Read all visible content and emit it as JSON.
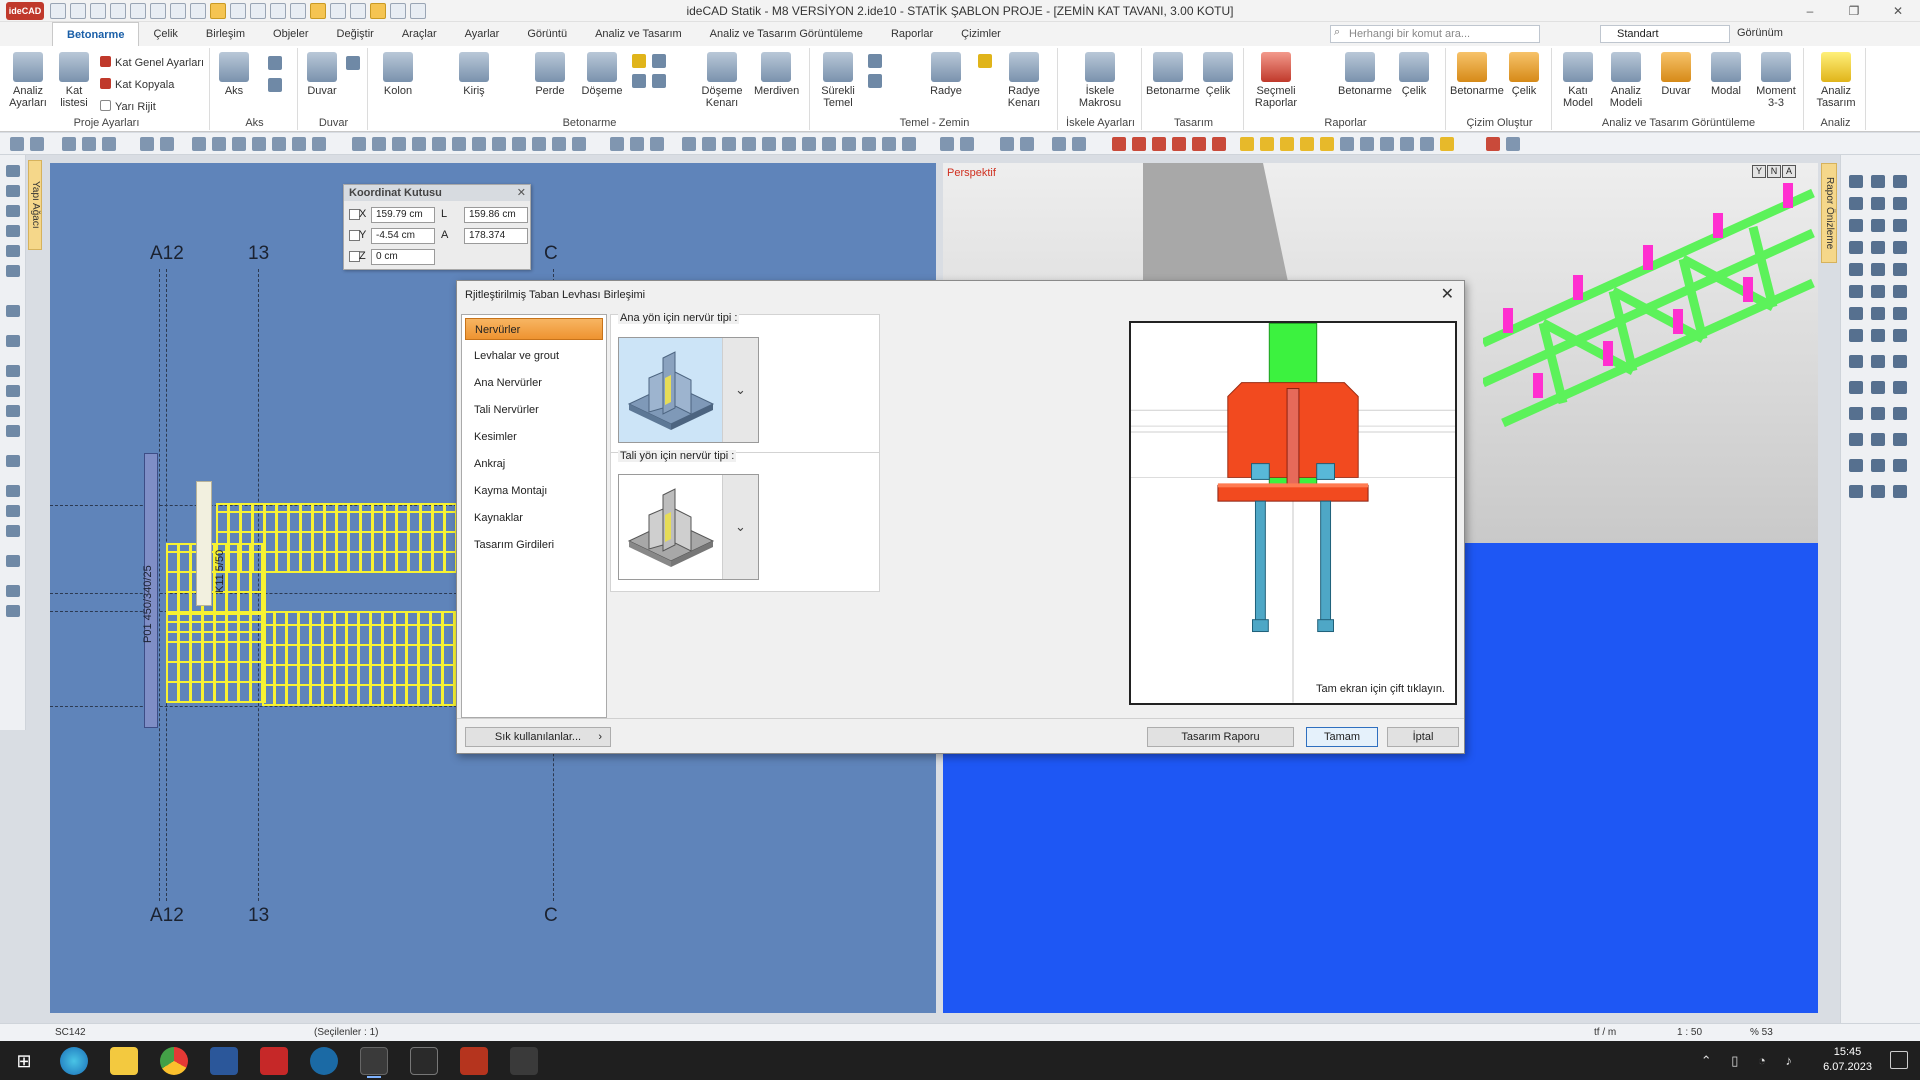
{
  "app": {
    "title": "ideCAD Statik - M8 VERSİYON 2.ide10 - STATİK ŞABLON PROJE - [ZEMİN KAT TAVANI,  3.00 KOTU]",
    "logo_text": "ideCAD"
  },
  "ribbon_tabs": [
    "Betonarme",
    "Çelik",
    "Birleşim",
    "Objeler",
    "Değiştir",
    "Araçlar",
    "Ayarlar",
    "Görüntü",
    "Analiz ve Tasarım",
    "Analiz ve Tasarım Görüntüleme",
    "Raporlar",
    "Çizimler"
  ],
  "active_tab": "Betonarme",
  "search": {
    "placeholder": "Herhangi bir komut ara..."
  },
  "style_select": {
    "value": "Standart"
  },
  "view_label": "Görünüm",
  "ribbon": {
    "proje_ayarlari": {
      "label": "Proje Ayarları",
      "analiz_ayarlari": "Analiz Ayarları",
      "kat_listesi": "Kat listesi",
      "kat_genel_ayarlari": "Kat Genel Ayarları",
      "kat_kopyala": "Kat Kopyala",
      "yari_rijit": "Yarı Rijit"
    },
    "aks": {
      "label": "Aks",
      "btn": "Aks"
    },
    "duvar": {
      "label": "Duvar",
      "btn": "Duvar"
    },
    "betonarme": {
      "label": "Betonarme",
      "kolon": "Kolon",
      "kiris": "Kiriş",
      "perde": "Perde",
      "doseme": "Döşeme",
      "doseme_kenari": "Döşeme Kenarı",
      "merdiven": "Merdiven"
    },
    "temel": {
      "label": "Temel - Zemin",
      "surekli_temel": "Sürekli Temel",
      "radye": "Radye",
      "radye_kenari": "Radye Kenarı"
    },
    "iskele": {
      "label": "İskele Ayarları",
      "btn": "İskele Makrosu"
    },
    "tasarim": {
      "label": "Tasarım",
      "betonarme": "Betonarme",
      "celik": "Çelik"
    },
    "raporlar": {
      "label": "Raporlar",
      "secmeli": "Seçmeli Raporlar",
      "betonarme": "Betonarme",
      "celik": "Çelik"
    },
    "cizim": {
      "label": "Çizim Oluştur",
      "betonarme": "Betonarme",
      "celik": "Çelik"
    },
    "analiz_gor": {
      "label": "Analiz ve Tasarım Görüntüleme",
      "katl_model": "Katı Model",
      "analiz_modeli": "Analiz Modeli",
      "duvar": "Duvar",
      "modal": "Modal",
      "moment": "Moment 3-3"
    },
    "analiz": {
      "label": "Analiz",
      "btn": "Analiz Tasarım"
    }
  },
  "coord_box": {
    "title": "Koordinat Kutusu",
    "x_label": "X",
    "x_value": "159.79 cm",
    "y_label": "Y",
    "y_value": "-4.54 cm",
    "z_label": "Z",
    "z_value": "0 cm",
    "l_label": "L",
    "l_value": "159.86 cm",
    "a_label": "A",
    "a_value": "178.374"
  },
  "plan": {
    "axes_top": [
      "A12",
      "13",
      "C"
    ],
    "axes_bottom": [
      "A12",
      "13",
      "C"
    ],
    "beam_label": "P01 450/340/25",
    "column_label": "K11 5/50"
  },
  "perspective": {
    "label": "Perspektif",
    "controls": [
      "Y",
      "N",
      "A"
    ]
  },
  "side_tabs": {
    "left": "Yapı Ağacı",
    "right": "Rapor Önizleme"
  },
  "dialog": {
    "title": "Rjitleştirilmiş Taban Levhası Birleşimi",
    "nav_items": [
      "Nervürler",
      "Levhalar ve grout",
      "Ana Nervürler",
      "Tali Nervürler",
      "Kesimler",
      "Ankraj",
      "Kayma Montajı",
      "Kaynaklar",
      "Tasarım Girdileri"
    ],
    "active_nav": "Nervürler",
    "main_rib_label": "Ana yön için nervür tipi :",
    "sec_rib_label": "Tali yön için nervür tipi :",
    "preview_hint": "Tam ekran için çift tıklayın.",
    "frequent_button": "Sık kullanılanlar...",
    "report_button": "Tasarım Raporu",
    "ok_button": "Tamam",
    "cancel_button": "İptal"
  },
  "status": {
    "object_id": "SC142",
    "selection": "(Seçilenler : 1)",
    "unit": "tf / m",
    "scale": "1 : 50",
    "zoom": "% 53"
  },
  "taskbar": {
    "time": "15:45",
    "date": "6.07.2023",
    "apps": [
      "start",
      "edge",
      "explorer",
      "chrome",
      "word",
      "autocad",
      "steam",
      "idecad",
      "epic-games",
      "app-red",
      "acrobat"
    ],
    "active_app": "idecad"
  },
  "colors": {
    "plan_bg": "#5f84ba",
    "persp_bg": "#1e57f4",
    "plan_grid": "#f7f232",
    "truss_green": "#5cf25a",
    "truss_magenta": "#ff2fd0",
    "base_plate": "#f24a1f",
    "column_green": "#36f23a",
    "nav_active": "#f29b3a"
  }
}
